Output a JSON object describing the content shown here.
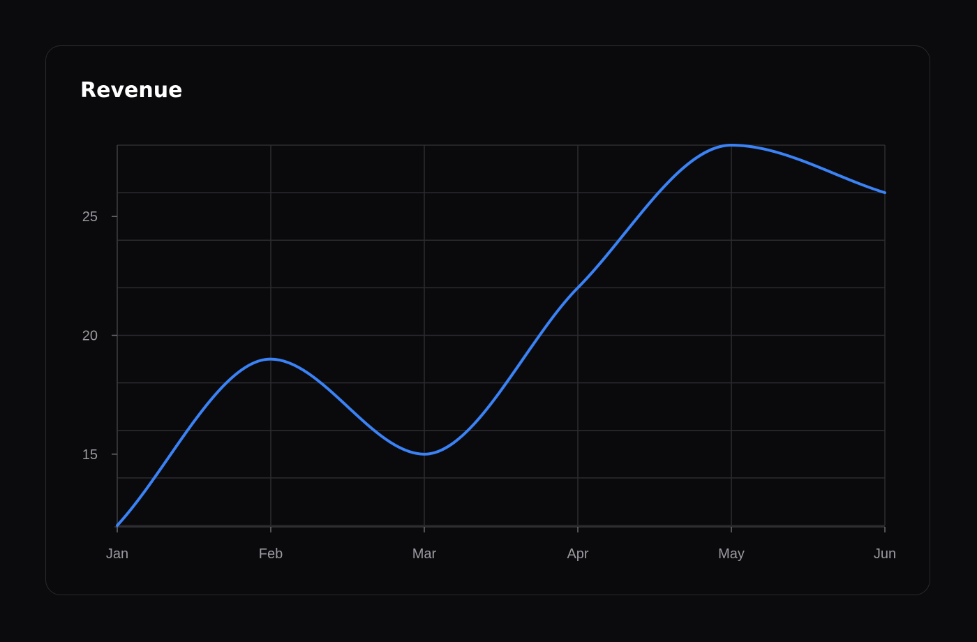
{
  "card": {
    "title": "Revenue"
  },
  "chart_data": {
    "type": "line",
    "title": "Revenue",
    "xlabel": "",
    "ylabel": "",
    "categories": [
      "Jan",
      "Feb",
      "Mar",
      "Apr",
      "May",
      "Jun"
    ],
    "series": [
      {
        "values": [
          12,
          19,
          15,
          22,
          28,
          26
        ]
      }
    ],
    "ylim": [
      12,
      28
    ],
    "yticks": [
      15,
      20,
      25
    ],
    "ygrid_step": 2,
    "grid": true,
    "curve": "smooth",
    "colors": {
      "line": "#3b82f6",
      "grid": "#2c2c30",
      "tick_text": "#9a9aa0",
      "background": "#0a0a0d"
    }
  }
}
